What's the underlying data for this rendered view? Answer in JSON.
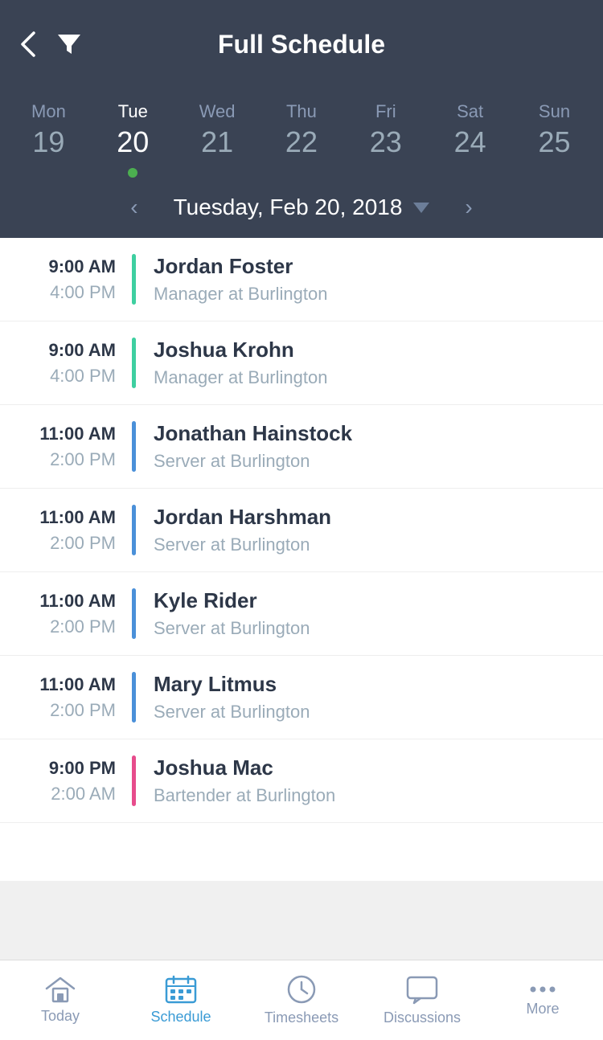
{
  "header": {
    "title": "Full Schedule",
    "back_label": "Back",
    "filter_label": "Filter"
  },
  "calendar": {
    "days": [
      {
        "name": "Mon",
        "num": "19",
        "active": false,
        "dot": false
      },
      {
        "name": "Tue",
        "num": "20",
        "active": true,
        "dot": true
      },
      {
        "name": "Wed",
        "num": "21",
        "active": false,
        "dot": false
      },
      {
        "name": "Thu",
        "num": "22",
        "active": false,
        "dot": false
      },
      {
        "name": "Fri",
        "num": "23",
        "active": false,
        "dot": false
      },
      {
        "name": "Sat",
        "num": "24",
        "active": false,
        "dot": false
      },
      {
        "name": "Sun",
        "num": "25",
        "active": false,
        "dot": false
      }
    ],
    "selected_date": "Tuesday, Feb 20, 2018"
  },
  "schedule": {
    "items": [
      {
        "start": "9:00 AM",
        "end": "4:00 PM",
        "name": "Jordan Foster",
        "role": "Manager at Burlington",
        "color": "teal"
      },
      {
        "start": "9:00 AM",
        "end": "4:00 PM",
        "name": "Joshua Krohn",
        "role": "Manager at Burlington",
        "color": "teal"
      },
      {
        "start": "11:00 AM",
        "end": "2:00 PM",
        "name": "Jonathan Hainstock",
        "role": "Server at Burlington",
        "color": "blue"
      },
      {
        "start": "11:00 AM",
        "end": "2:00 PM",
        "name": "Jordan Harshman",
        "role": "Server at Burlington",
        "color": "blue"
      },
      {
        "start": "11:00 AM",
        "end": "2:00 PM",
        "name": "Kyle Rider",
        "role": "Server at Burlington",
        "color": "blue"
      },
      {
        "start": "11:00 AM",
        "end": "2:00 PM",
        "name": "Mary Litmus",
        "role": "Server at Burlington",
        "color": "blue"
      },
      {
        "start": "9:00 PM",
        "end": "2:00 AM",
        "name": "Joshua Mac",
        "role": "Bartender at Burlington",
        "color": "pink"
      }
    ]
  },
  "bottom_nav": {
    "items": [
      {
        "label": "Today",
        "icon": "home-icon",
        "active": false
      },
      {
        "label": "Schedule",
        "icon": "calendar-icon",
        "active": true
      },
      {
        "label": "Timesheets",
        "icon": "clock-icon",
        "active": false
      },
      {
        "label": "Discussions",
        "icon": "chat-icon",
        "active": false
      },
      {
        "label": "More",
        "icon": "more-icon",
        "active": false
      }
    ]
  }
}
